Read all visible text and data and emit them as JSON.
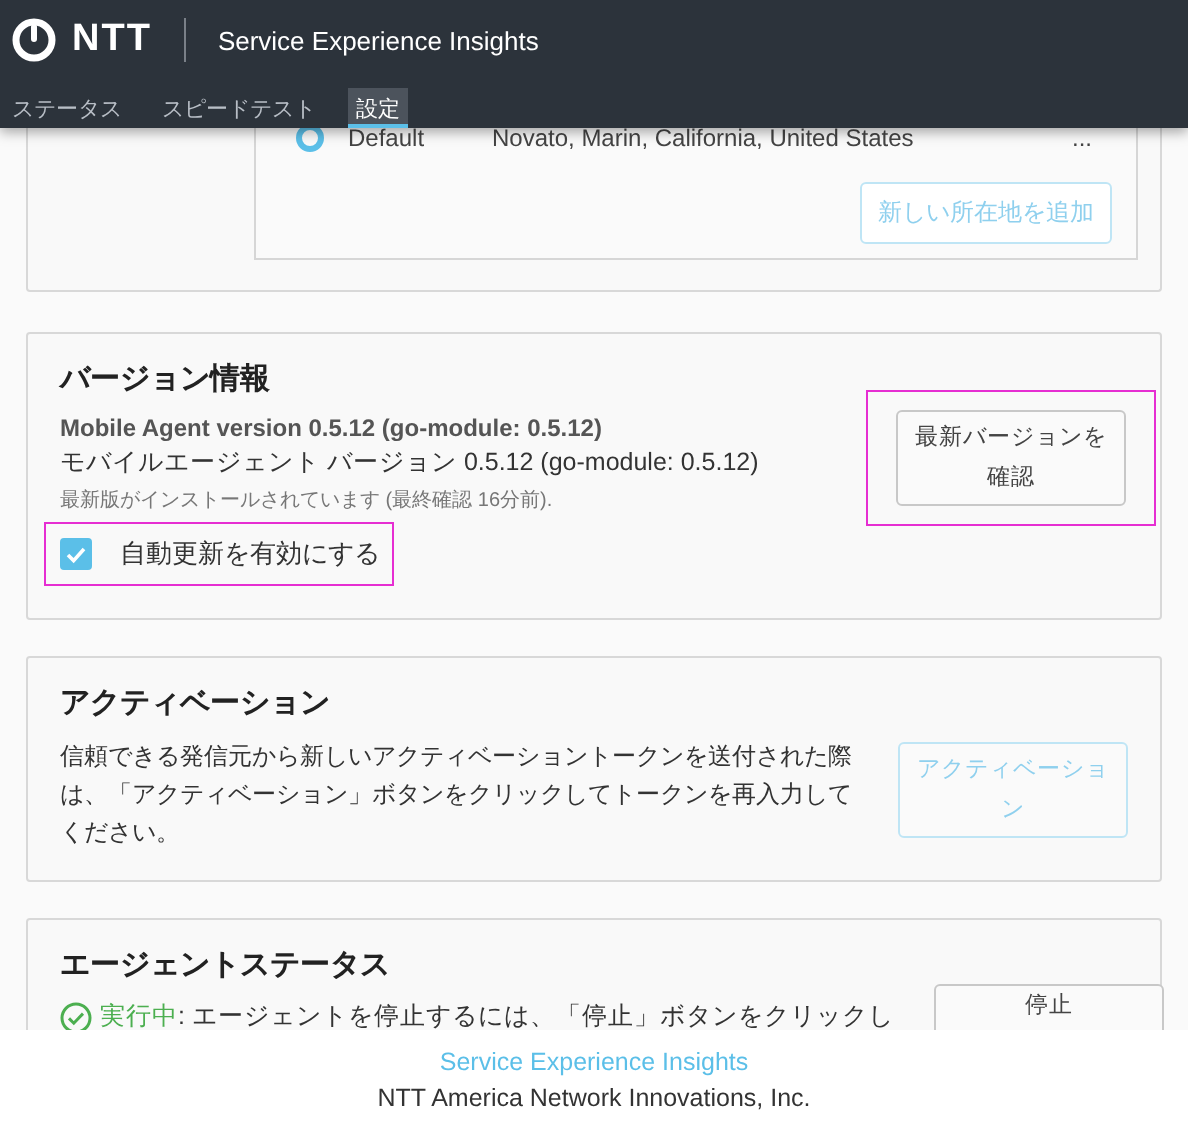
{
  "header": {
    "logo": "NTT",
    "title": "Service Experience Insights"
  },
  "tabs": [
    {
      "label": "ステータス",
      "selected": false
    },
    {
      "label": "スピードテスト",
      "selected": false
    },
    {
      "label": "設定",
      "selected": true
    }
  ],
  "locations": {
    "rows": [
      {
        "name": "Default",
        "address": "Novato, Marin, California, United States",
        "selected": true,
        "more": "..."
      }
    ],
    "add_button": "新しい所在地を追加"
  },
  "version": {
    "title": "バージョン情報",
    "agent_version": "Mobile Agent version 0.5.12 (go-module: 0.5.12)",
    "agent_version_ja": "モバイルエージェント バージョン 0.5.12 (go-module: 0.5.12)",
    "status_note": "最新版がインストールされています (最終確認 16分前).",
    "auto_update": {
      "label": "自動更新を有効にする",
      "checked": true,
      "highlighted": true
    },
    "check_button": {
      "label": "最新バージョンを確認",
      "highlighted": true
    }
  },
  "activation": {
    "title": "アクティベーション",
    "description": "信頼できる発信元から新しいアクティベーショントークンを送付された際は、「アクティベーション」ボタンをクリックしてトークンを再入力してください。",
    "button": {
      "label": "アクティベーション",
      "disabled": true
    }
  },
  "agent_status": {
    "title": "エージェントステータス",
    "state": "実行中",
    "running": true,
    "message": ": エージェントを停止するには、「停止」ボタンをクリックし",
    "button": "停止"
  },
  "footer": {
    "link": "Service Experience Insights",
    "company": "NTT America Network Innovations, Inc."
  }
}
